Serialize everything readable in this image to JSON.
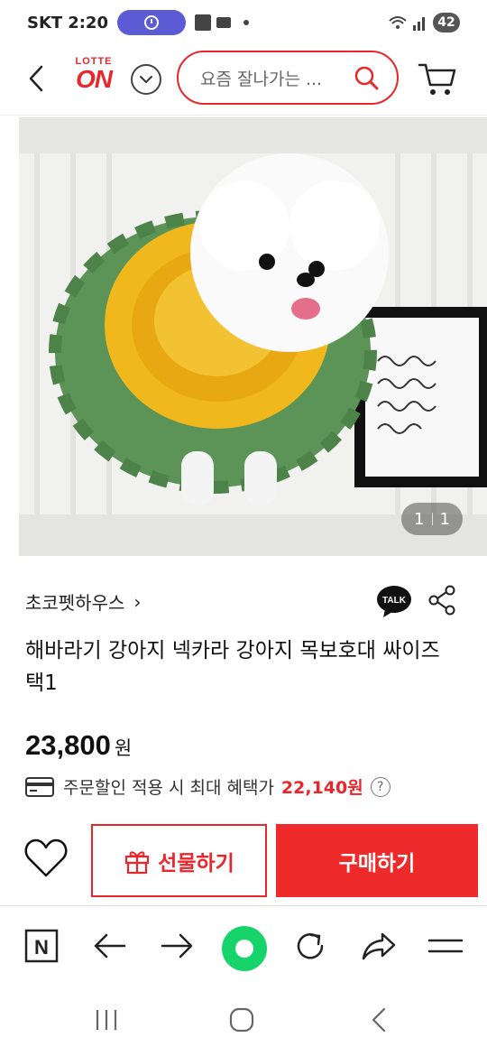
{
  "status_bar": {
    "carrier": "SKT",
    "time": "2:20",
    "battery": "42"
  },
  "header": {
    "logo_top": "LOTTE",
    "logo_bottom": "ON",
    "search_placeholder": "요즘 잘나가는 ..."
  },
  "product_image": {
    "counter_current": "1",
    "counter_total": "1"
  },
  "seller": {
    "name": "초코펫하우스",
    "chevron": "›"
  },
  "product": {
    "title": "해바라기 강아지 넥카라 강아지 목보호대 싸이즈 택1",
    "price": "23,800",
    "currency": "원",
    "benefit_text": "주문할인 적용 시 최대 혜택가",
    "benefit_amount": "22,140원",
    "help_glyph": "?"
  },
  "actions": {
    "gift_label": "선물하기",
    "buy_label": "구매하기",
    "talk_label": "TALK"
  },
  "browser_toolbar": {
    "n_label": "N"
  },
  "colors": {
    "brand_red": "#e8262b",
    "buy_red": "#ee2a2a",
    "green": "#16d36a"
  },
  "icons": [
    "back-icon",
    "chevron-down-icon",
    "search-icon",
    "cart-icon",
    "talk-icon",
    "share-icon",
    "card-icon",
    "help-icon",
    "heart-icon",
    "gift-icon",
    "naver-icon",
    "arrow-left-icon",
    "arrow-right-icon",
    "refresh-icon",
    "share-arrow-icon",
    "menu-icon",
    "recent-apps-icon",
    "home-icon",
    "system-back-icon"
  ]
}
